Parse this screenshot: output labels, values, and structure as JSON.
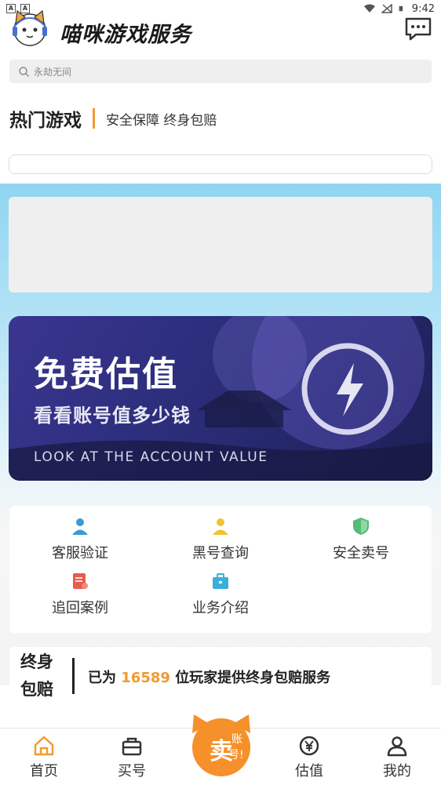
{
  "status_bar": {
    "time": "9:42",
    "left_badges": [
      "A",
      "A"
    ]
  },
  "header": {
    "title": "喵咪游戏服务"
  },
  "search": {
    "placeholder": "永劫无间"
  },
  "hot": {
    "title": "热门游戏",
    "subtitle": "安全保障 终身包赔"
  },
  "banner": {
    "title": "免费估值",
    "subtitle": "看看账号值多少钱",
    "english": "LOOK AT THE ACCOUNT VALUE"
  },
  "services": [
    {
      "label": "客服验证",
      "icon": "customer-service-icon",
      "color": "#3a9ad9"
    },
    {
      "label": "黑号查询",
      "icon": "user-search-icon",
      "color": "#f1c232"
    },
    {
      "label": "安全卖号",
      "icon": "shield-icon",
      "color": "#55bb77"
    },
    {
      "label": "追回案例",
      "icon": "document-icon",
      "color": "#e85c4a"
    },
    {
      "label": "业务介绍",
      "icon": "briefcase-icon",
      "color": "#3ab0d8"
    }
  ],
  "guarantee": {
    "label": "终身包赔",
    "text_before": "已为",
    "count": "16589",
    "text_after": "位玩家提供终身包赔服务"
  },
  "nav": {
    "home": "首页",
    "buy": "买号",
    "sell_line1": "卖",
    "sell_line2": "账",
    "sell_line3": "号!",
    "value": "估值",
    "mine": "我的"
  },
  "colors": {
    "accent": "#f19a33",
    "banner": "#2b2d7a",
    "sky": "#8fd5f2"
  }
}
